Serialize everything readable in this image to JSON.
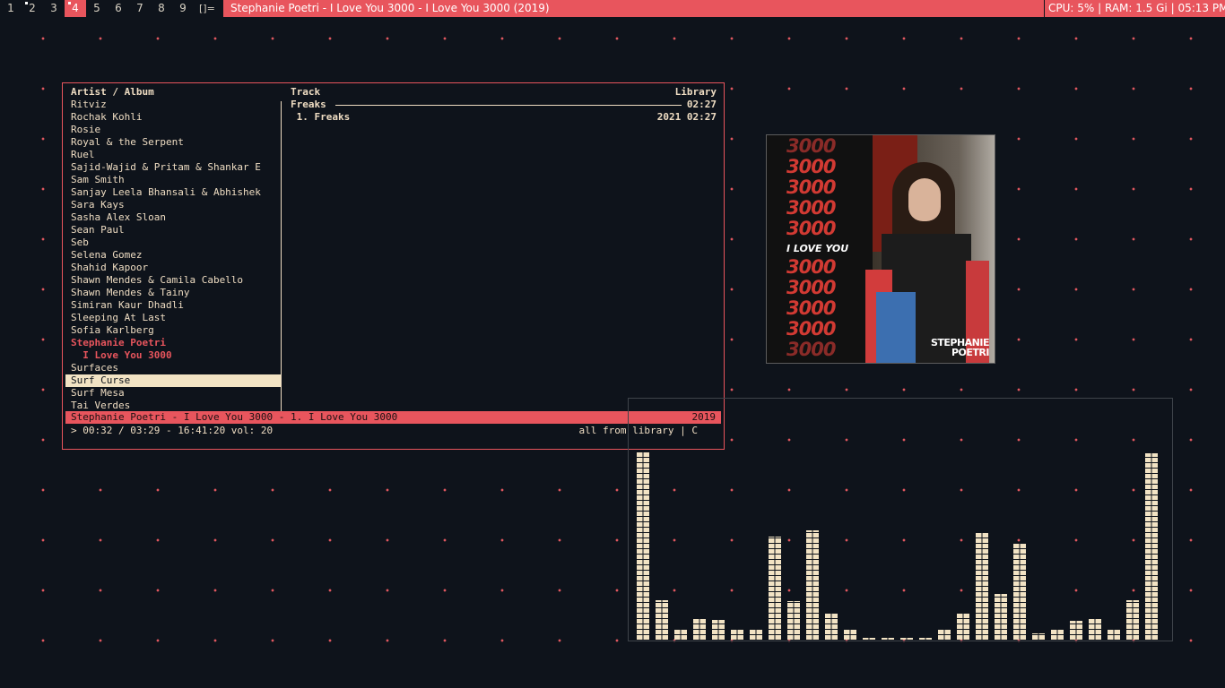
{
  "topbar": {
    "workspaces": [
      {
        "label": "1",
        "active": false,
        "marked": false
      },
      {
        "label": "2",
        "active": false,
        "marked": true
      },
      {
        "label": "3",
        "active": false,
        "marked": false
      },
      {
        "label": "4",
        "active": true,
        "marked": true
      },
      {
        "label": "5",
        "active": false,
        "marked": false
      },
      {
        "label": "6",
        "active": false,
        "marked": false
      },
      {
        "label": "7",
        "active": false,
        "marked": false
      },
      {
        "label": "8",
        "active": false,
        "marked": false
      },
      {
        "label": "9",
        "active": false,
        "marked": false
      }
    ],
    "layout_symbol": "[]=",
    "window_title": "Stephanie Poetri - I Love You 3000 - I Love You 3000 (2019)",
    "system_status": "CPU: 5% |  RAM: 1.5 Gi | 05:13 PM"
  },
  "player": {
    "left_header": "Artist / Album",
    "track_header": "Track",
    "library_header": "Library",
    "artists": [
      {
        "label": "Ritviz",
        "state": "normal"
      },
      {
        "label": "Rochak Kohli",
        "state": "normal"
      },
      {
        "label": "Rosie",
        "state": "normal"
      },
      {
        "label": "Royal & the Serpent",
        "state": "normal"
      },
      {
        "label": "Ruel",
        "state": "normal"
      },
      {
        "label": "Sajid-Wajid & Pritam & Shankar E",
        "state": "normal"
      },
      {
        "label": "Sam Smith",
        "state": "normal"
      },
      {
        "label": "Sanjay Leela Bhansali & Abhishek",
        "state": "normal"
      },
      {
        "label": "Sara Kays",
        "state": "normal"
      },
      {
        "label": "Sasha Alex Sloan",
        "state": "normal"
      },
      {
        "label": "Sean Paul",
        "state": "normal"
      },
      {
        "label": "Seb",
        "state": "normal"
      },
      {
        "label": "Selena Gomez",
        "state": "normal"
      },
      {
        "label": "Shahid Kapoor",
        "state": "normal"
      },
      {
        "label": "Shawn Mendes & Camila Cabello",
        "state": "normal"
      },
      {
        "label": "Shawn Mendes & Tainy",
        "state": "normal"
      },
      {
        "label": "Simiran Kaur Dhadli",
        "state": "normal"
      },
      {
        "label": "Sleeping At Last",
        "state": "normal"
      },
      {
        "label": "Sofia Karlberg",
        "state": "normal"
      },
      {
        "label": "Stephanie Poetri",
        "state": "current"
      },
      {
        "label": "  I Love You 3000",
        "state": "current"
      },
      {
        "label": "Surfaces",
        "state": "normal"
      },
      {
        "label": "Surf Curse",
        "state": "selected"
      },
      {
        "label": "Surf Mesa",
        "state": "normal"
      },
      {
        "label": "Tai Verdes",
        "state": "normal"
      }
    ],
    "album_name": "Freaks",
    "album_duration": "02:27",
    "tracks": [
      {
        "label": " 1. Freaks",
        "meta": "2021 02:27"
      }
    ],
    "now_playing_left": "Stephanie Poetri - I Love You 3000 -  1. I Love You 3000",
    "now_playing_year": "2019",
    "progress_line": "> 00:32 / 03:29 - 16:41:20 vol: 20",
    "mode_line": "all from library | C"
  },
  "album_art": {
    "repeat_text": "3000",
    "tagline": "I LOVE YOU",
    "artist_line1": "STEPHANIE",
    "artist_line2": "POETRI"
  },
  "visualizer": {
    "max_level": 210,
    "levels": [
      210,
      44,
      12,
      24,
      22,
      12,
      12,
      115,
      43,
      122,
      30,
      12,
      2,
      2,
      2,
      2,
      12,
      30,
      120,
      51,
      107,
      7,
      12,
      21,
      23,
      12,
      44,
      208
    ]
  },
  "colors": {
    "accent": "#e8555d",
    "foreground": "#eedcc2",
    "background": "#0e131b",
    "selection": "#f2e3c4"
  }
}
